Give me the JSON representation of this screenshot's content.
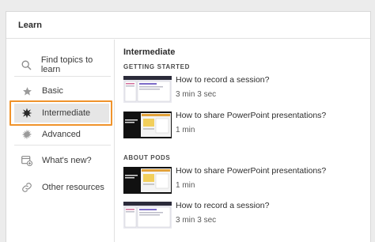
{
  "header": {
    "title": "Learn"
  },
  "sidebar": {
    "items": [
      {
        "label": "Find topics to learn",
        "icon": "search-icon"
      },
      {
        "label": "Basic",
        "icon": "star-icon"
      },
      {
        "label": "Intermediate",
        "icon": "starburst-icon"
      },
      {
        "label": "Advanced",
        "icon": "sunburst-icon"
      },
      {
        "label": "What's new?",
        "icon": "whats-new-icon"
      },
      {
        "label": "Other resources",
        "icon": "link-icon"
      }
    ],
    "active": "Intermediate",
    "highlight_color": "#f0932b"
  },
  "main": {
    "title": "Intermediate",
    "sections": [
      {
        "heading": "GETTING STARTED",
        "videos": [
          {
            "title": "How to record a session?",
            "duration": "3 min 3 sec"
          },
          {
            "title": "How to share PowerPoint presentations?",
            "duration": "1 min"
          }
        ]
      },
      {
        "heading": "ABOUT PODS",
        "videos": [
          {
            "title": "How to share PowerPoint presentations?",
            "duration": "1 min"
          },
          {
            "title": "How to record a session?",
            "duration": "3 min 3 sec"
          }
        ]
      }
    ]
  }
}
